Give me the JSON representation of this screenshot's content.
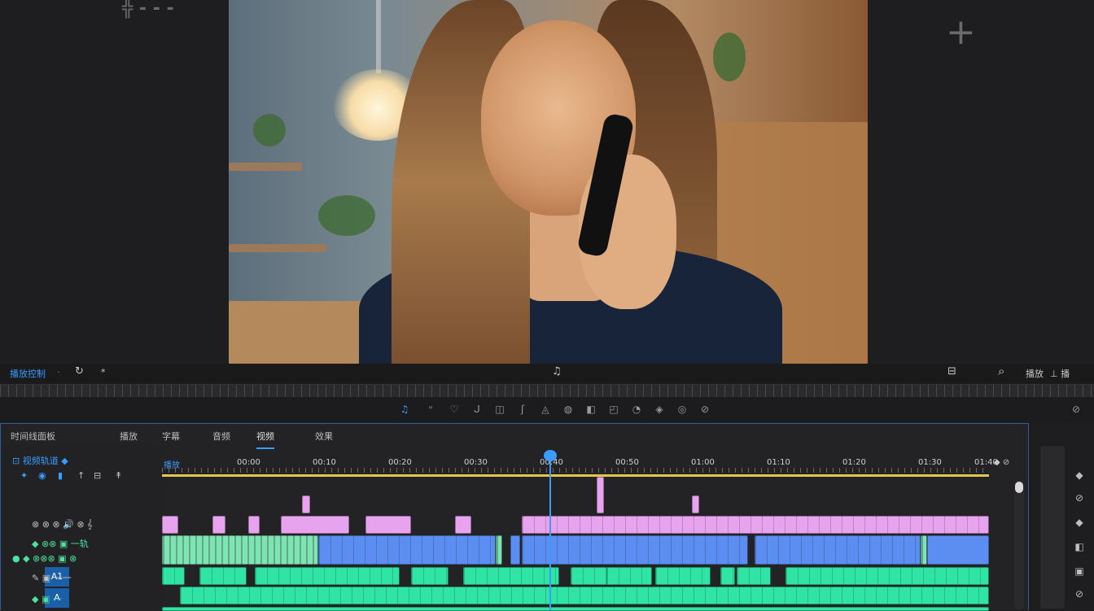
{
  "monitor": {
    "corner_left": "╬ - - -",
    "corner_right": "+"
  },
  "controls": {
    "left_label": "播放控制",
    "left_dot": "·",
    "left_icon": "↻",
    "left_icon2": "*",
    "center_icon": "♫",
    "right_icon": "⊟",
    "search_icon": "⌕",
    "right_label": "播放",
    "right_label2": "⊥ 播"
  },
  "tools": [
    "♫",
    "ᐡ",
    "♡",
    "ᒍ",
    "◫",
    "ʃ",
    "◬",
    "◍",
    "◧",
    "◰",
    "◔",
    "◈",
    "◎",
    "⊘"
  ],
  "tools_right": "⊘",
  "timeline": {
    "title": "时间线面板",
    "tabs": [
      "播放",
      "字幕",
      "音频",
      "视频",
      "效果"
    ],
    "selected_tab": 3,
    "header": {
      "row1": "⊡ 视频轨道 ◆",
      "row2": [
        "✦",
        "◉",
        "▮",
        "↑",
        "⊟",
        "↟"
      ],
      "row3": "⊗ ⊗ ⊗ 🔊 ⊗ 𝄞",
      "row4": "◆ ⊗⊗ ▣ 一轨",
      "row5": "● ◆ ⊗⊗⊗ ▣ ⊗",
      "row6": "✎ ▣ 一一",
      "row7": "◆ ▣ 一"
    },
    "targets": [
      "A1",
      "A"
    ],
    "ruler": [
      "播放",
      "00:00",
      "00:10",
      "00:20",
      "00:30",
      "00:40",
      "00:50",
      "01:00",
      "01:10",
      "01:20",
      "01:30",
      "01:40"
    ],
    "ruler_end": "◆ ⊘"
  },
  "sidepanel": [
    "◆",
    "⊘",
    "◆",
    "◧",
    "▣",
    "⊘"
  ]
}
